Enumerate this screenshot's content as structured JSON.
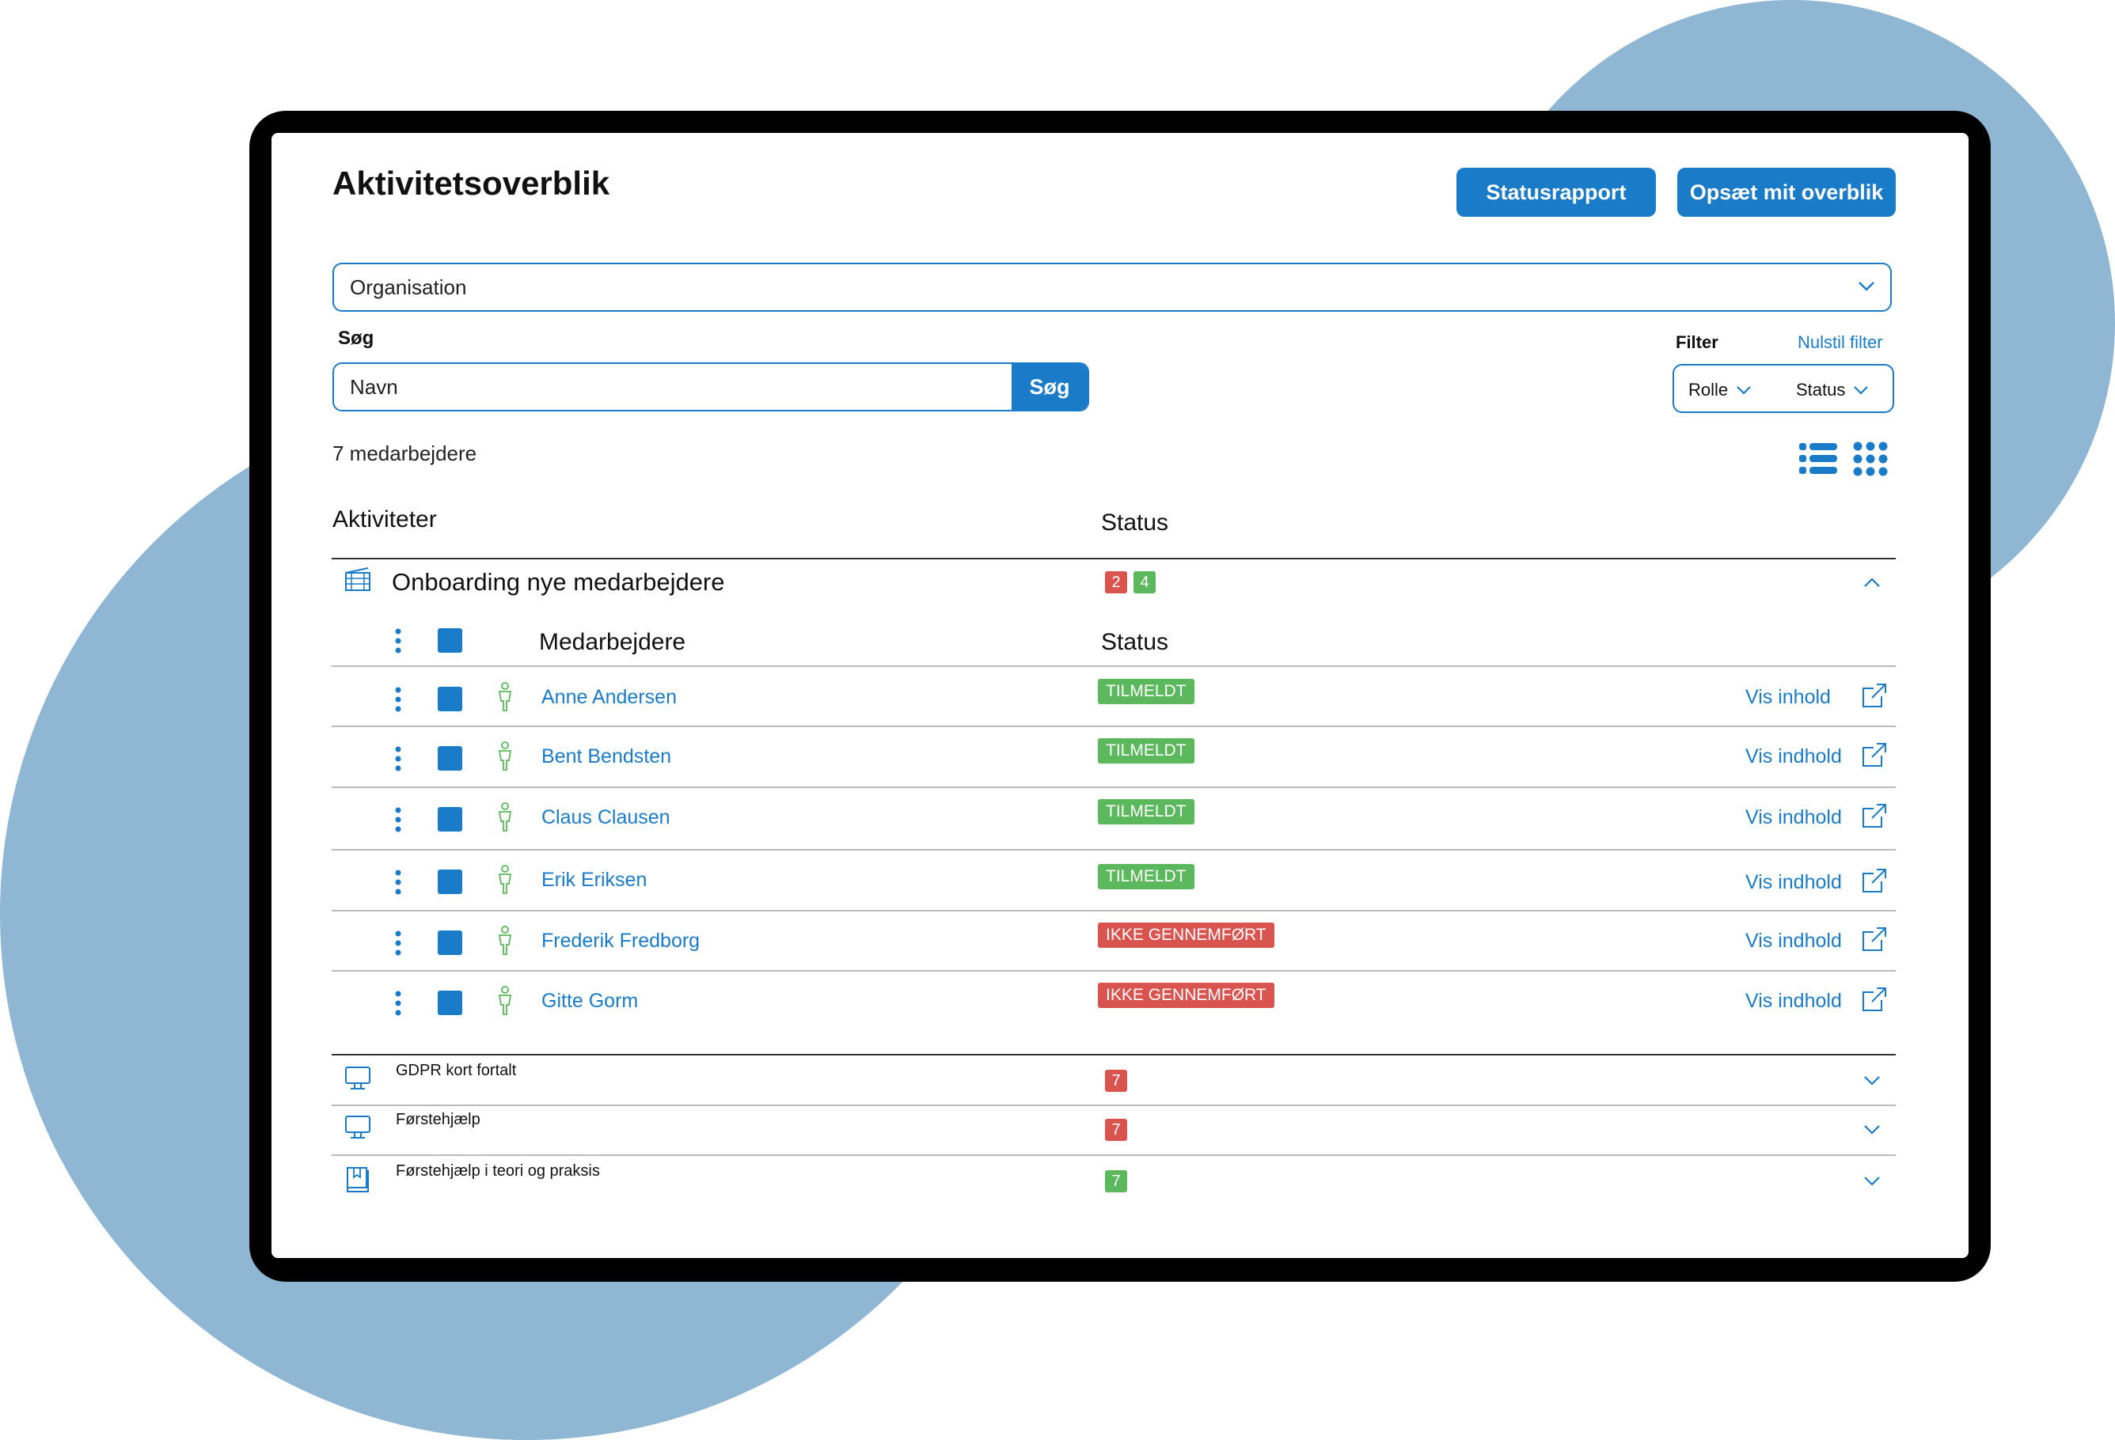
{
  "header": {
    "title": "Aktivitetsoverblik",
    "statusrapport_label": "Statusrapport",
    "setup_label": "Opsæt mit overblik"
  },
  "organisation": {
    "value": "Organisation"
  },
  "search": {
    "label": "Søg",
    "placeholder": "Navn",
    "button_label": "Søg"
  },
  "filter": {
    "label": "Filter",
    "reset_label": "Nulstil filter",
    "role_label": "Rolle",
    "status_label": "Status"
  },
  "employee_count": "7 medarbejdere",
  "table": {
    "activities_header": "Aktiviteter",
    "status_header": "Status"
  },
  "expanded_activity": {
    "title": "Onboarding nye medarbejdere",
    "counts": [
      "2",
      "4"
    ],
    "employees_header": "Medarbejdere",
    "status_header": "Status",
    "employees": [
      {
        "name": "Anne Andersen",
        "status": "TILMELDT",
        "status_color": "#5cb85c",
        "link": "Vis inhold"
      },
      {
        "name": "Bent Bendsten",
        "status": "TILMELDT",
        "status_color": "#5cb85c",
        "link": "Vis indhold"
      },
      {
        "name": "Claus Clausen",
        "status": "TILMELDT",
        "status_color": "#5cb85c",
        "link": "Vis indhold"
      },
      {
        "name": "Erik Eriksen",
        "status": "TILMELDT",
        "status_color": "#5cb85c",
        "link": "Vis indhold"
      },
      {
        "name": "Frederik Fredborg",
        "status": "IKKE GENNEMFØRT",
        "status_color": "#d9534f",
        "link": "Vis indhold"
      },
      {
        "name": "Gitte Gorm",
        "status": "IKKE GENNEMFØRT",
        "status_color": "#d9534f",
        "link": "Vis indhold"
      }
    ]
  },
  "activities": [
    {
      "title": "GDPR kort fortalt",
      "count": "7",
      "count_color": "#d9534f",
      "icon": "monitor-icon"
    },
    {
      "title": "Førstehjælp",
      "count": "7",
      "count_color": "#d9534f",
      "icon": "monitor-icon"
    },
    {
      "title": "Førstehjælp i teori og praksis",
      "count": "7",
      "count_color": "#5cb85c",
      "icon": "book-icon"
    }
  ],
  "colors": {
    "accent": "#1a7bc8",
    "success": "#5cb85c",
    "danger": "#d9534f",
    "background_blob": "#8fb6d3",
    "person_icon": "#5cb85c"
  }
}
